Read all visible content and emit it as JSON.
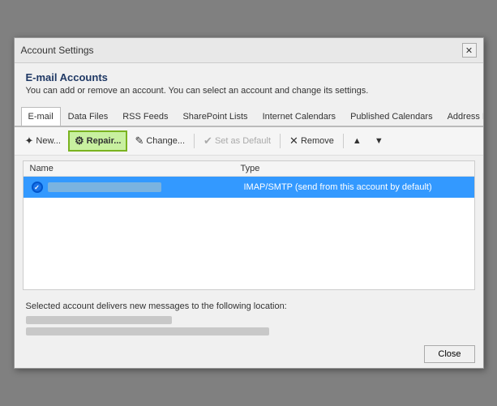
{
  "window": {
    "title": "Account Settings",
    "close_label": "✕"
  },
  "header": {
    "title": "E-mail Accounts",
    "description": "You can add or remove an account. You can select an account and change its settings."
  },
  "tabs": [
    {
      "label": "E-mail",
      "active": true
    },
    {
      "label": "Data Files",
      "active": false
    },
    {
      "label": "RSS Feeds",
      "active": false
    },
    {
      "label": "SharePoint Lists",
      "active": false
    },
    {
      "label": "Internet Calendars",
      "active": false
    },
    {
      "label": "Published Calendars",
      "active": false
    },
    {
      "label": "Address Books",
      "active": false
    }
  ],
  "toolbar": {
    "new_label": "New...",
    "repair_label": "Repair...",
    "change_label": "Change...",
    "set_default_label": "Set as Default",
    "remove_label": "Remove",
    "up_label": "▲",
    "down_label": "▼"
  },
  "table": {
    "columns": [
      {
        "label": "Name"
      },
      {
        "label": "Type"
      }
    ],
    "rows": [
      {
        "name": "",
        "type": "IMAP/SMTP (send from this account by default)",
        "selected": true,
        "has_check": true
      }
    ]
  },
  "footer": {
    "description": "Selected account delivers new messages to the following location:"
  },
  "bottom_button": {
    "label": "Close"
  }
}
